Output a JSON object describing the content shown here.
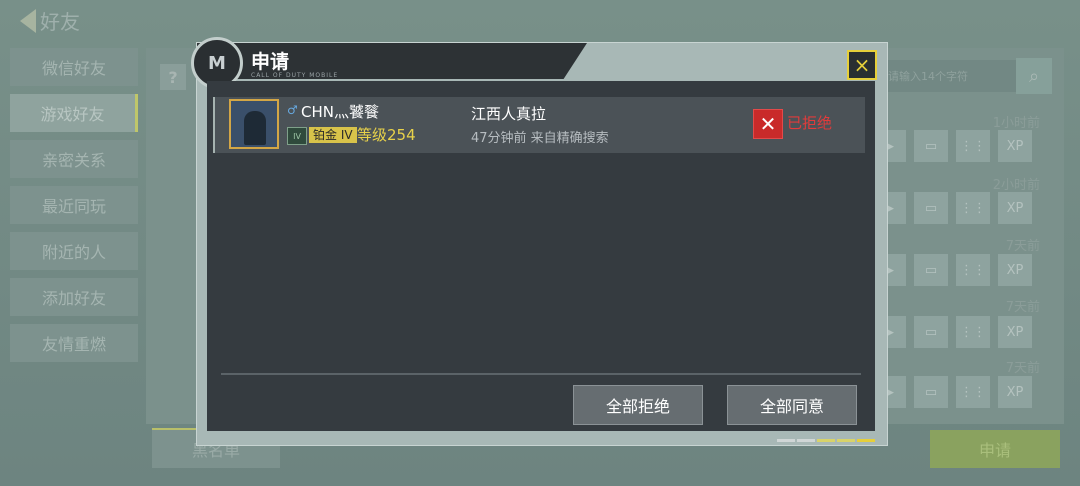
{
  "background": {
    "title": "好友",
    "sidebar": [
      "微信好友",
      "游戏好友",
      "亲密关系",
      "最近同玩",
      "附近的人",
      "添加好友",
      "友情重燃"
    ],
    "active_index": 1,
    "search_placeholder": "请输入14个字符",
    "times": [
      "1小时前",
      "2小时前",
      "7天前",
      "7天前",
      "7天前"
    ],
    "icon_xp": "XP",
    "blacklist": "黑名单",
    "apply": "申请"
  },
  "dialog": {
    "title": "申请",
    "subtitle": "CALL OF DUTY MOBILE",
    "close_icon": "×",
    "requests": [
      {
        "name": "CHN灬饕餮",
        "gender_icon": "♂",
        "rank": "铂金 IV",
        "level": "等级254",
        "message": "江西人真拉",
        "meta": "47分钟前 来自精确搜索",
        "status": "已拒绝"
      }
    ],
    "reject_all": "全部拒绝",
    "accept_all": "全部同意"
  },
  "colors": {
    "accent_yellow": "#e6cf3a",
    "reject_red": "#e23b3b",
    "dialog_bg": "#353b40"
  }
}
